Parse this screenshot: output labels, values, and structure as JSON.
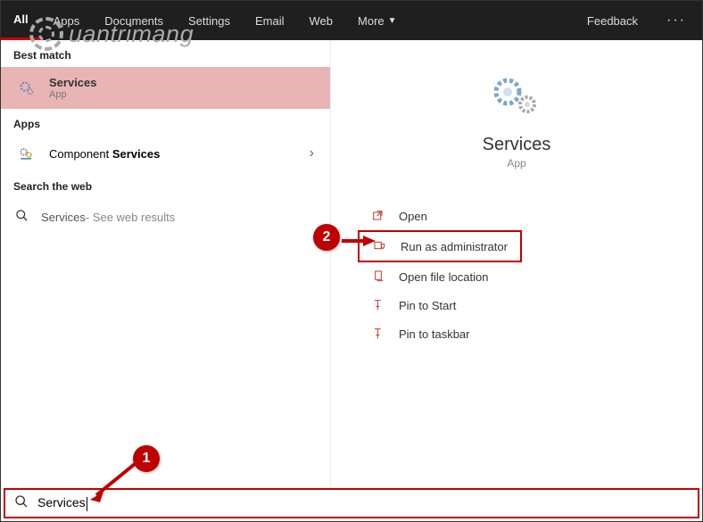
{
  "tabs": {
    "items": [
      {
        "label": "All",
        "active": true
      },
      {
        "label": "Apps"
      },
      {
        "label": "Documents"
      },
      {
        "label": "Settings"
      },
      {
        "label": "Email"
      },
      {
        "label": "Web"
      },
      {
        "label": "More",
        "dropdown": true
      }
    ],
    "feedback": "Feedback"
  },
  "watermark_text": "uantrimang",
  "left": {
    "best_match": "Best match",
    "best_item": {
      "title": "Services",
      "sub": "App"
    },
    "apps_header": "Apps",
    "component_prefix": "Component ",
    "component_bold": "Services",
    "web_header": "Search the web",
    "web_query": "Services",
    "web_suffix": " - See web results"
  },
  "right": {
    "title": "Services",
    "sub": "App",
    "actions": {
      "open": "Open",
      "run_admin": "Run as administrator",
      "open_loc": "Open file location",
      "pin_start": "Pin to Start",
      "pin_taskbar": "Pin to taskbar"
    }
  },
  "search": {
    "value": "Services"
  },
  "annotations": {
    "b1": "1",
    "b2": "2"
  }
}
